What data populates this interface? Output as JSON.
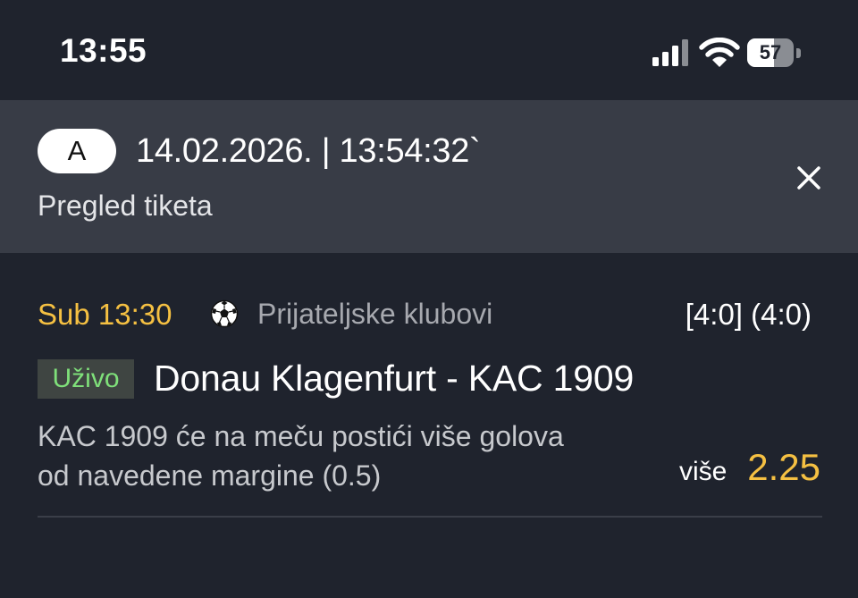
{
  "status_bar": {
    "time": "13:55",
    "battery_level": "57",
    "battery_fraction": 0.57,
    "icons": [
      "signal-icon",
      "wifi-icon",
      "battery-icon"
    ]
  },
  "ticket": {
    "badge": "A",
    "datetime": "14.02.2026. | 13:54:32`",
    "subtitle": "Pregled tiketa",
    "close_icon": "close-icon"
  },
  "match": {
    "time": "Sub 13:30",
    "sport_icon": "soccer-ball-icon",
    "league": "Prijateljske klubovi",
    "score": "[4:0] (4:0)",
    "live_label": "Uživo",
    "teams": "Donau Klagenfurt - KAC 1909",
    "description_line1": "KAC 1909 će na meču postići više golova",
    "description_line2": "od navedene margine (0.5)",
    "pick": "više",
    "odds": "2.25"
  },
  "colors": {
    "background": "#1f232d",
    "header_background": "#383c46",
    "accent_yellow": "#f5c042",
    "live_green": "#7fe07a"
  }
}
